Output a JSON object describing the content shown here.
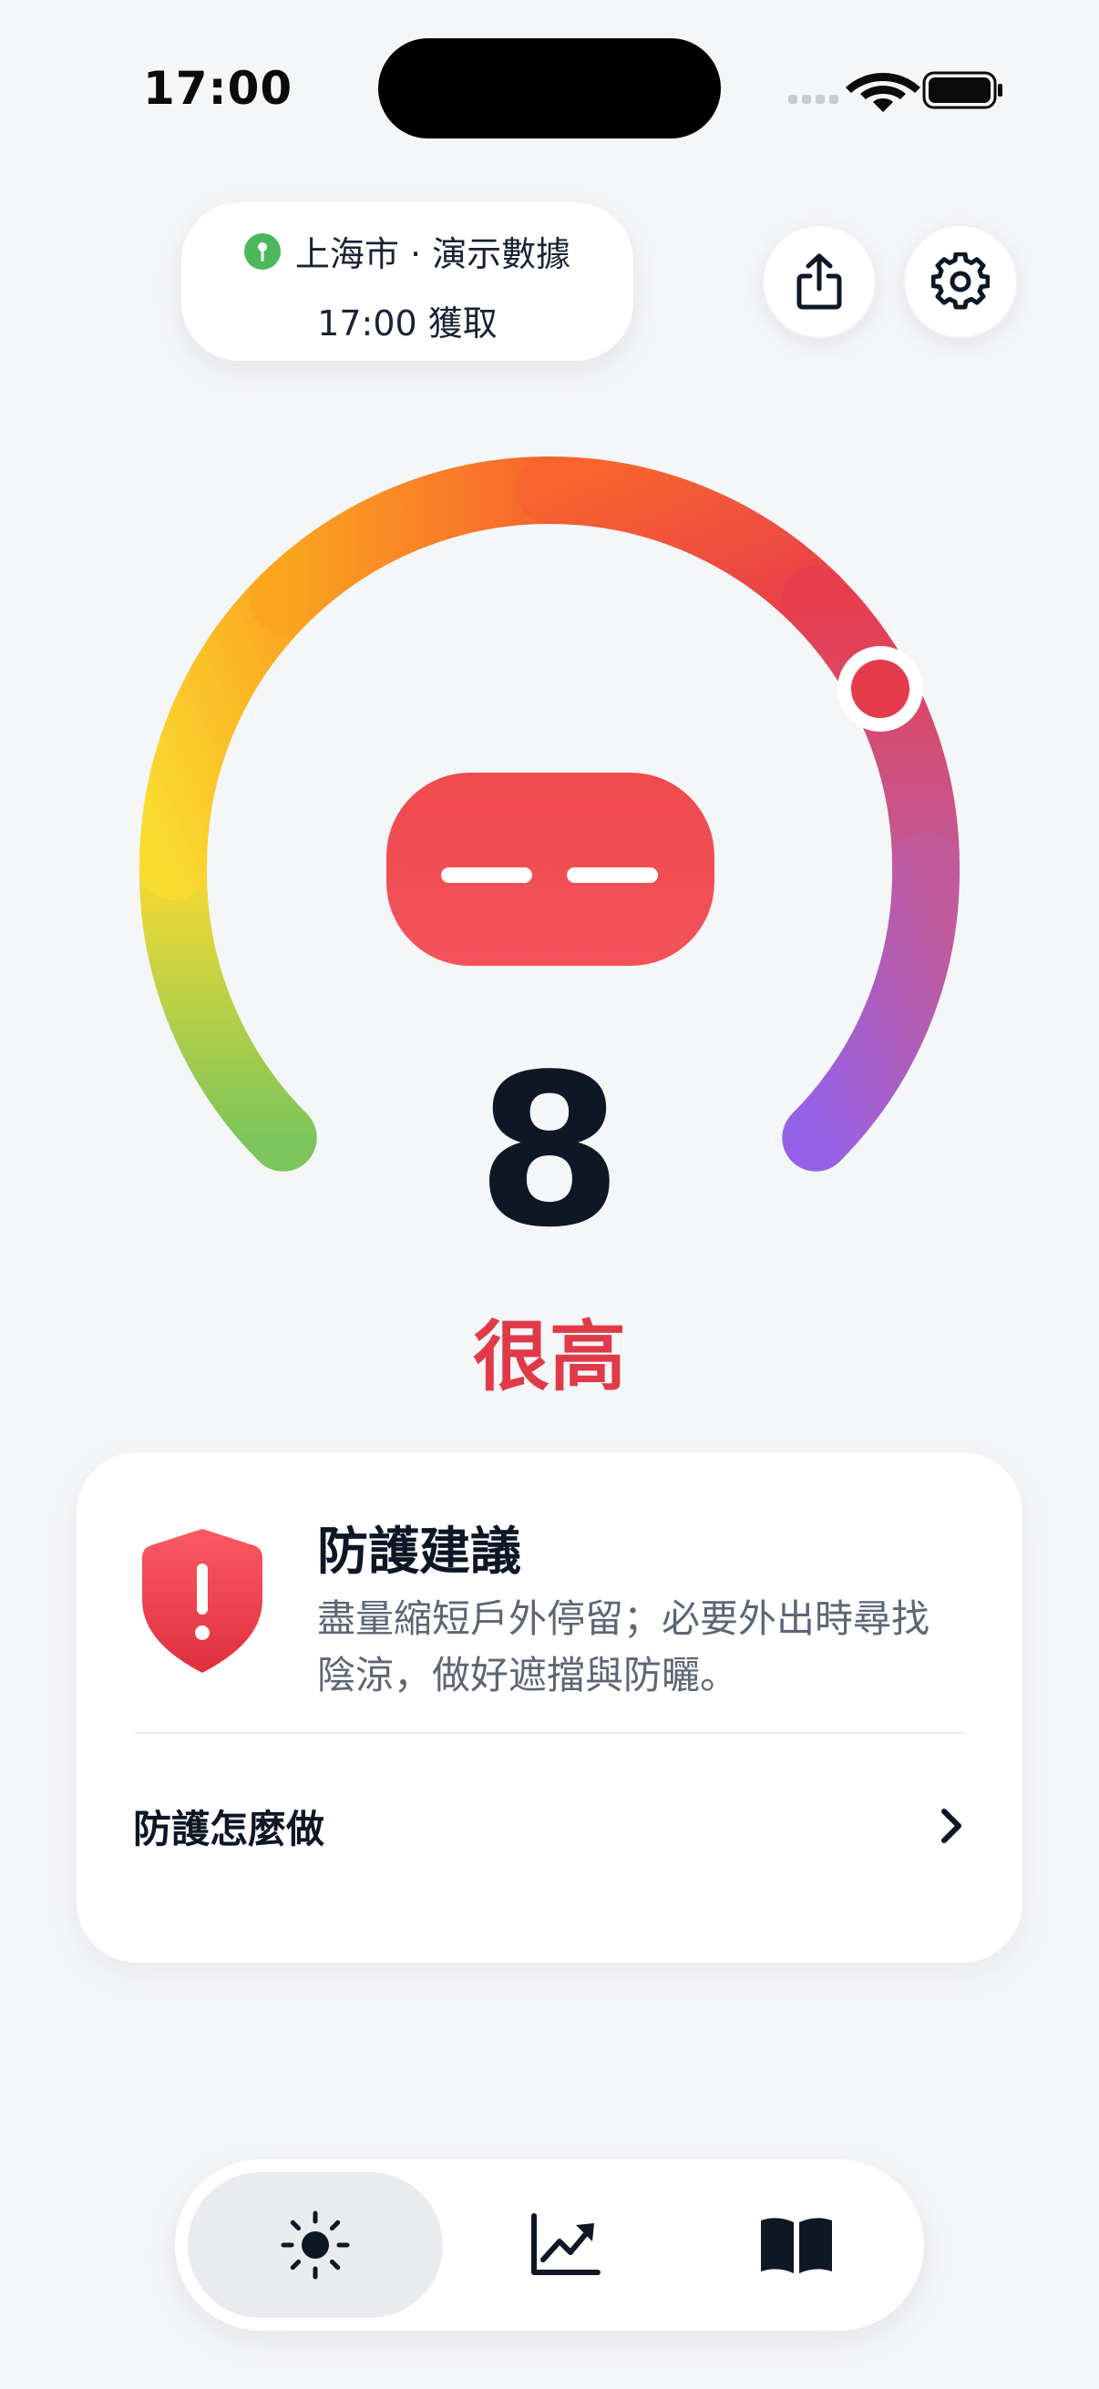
{
  "status_bar": {
    "time": "17:00"
  },
  "location": {
    "line1": "上海市 · 演示數據",
    "line2": "17:00 獲取"
  },
  "header_buttons": {
    "share_icon": "share-icon",
    "settings_icon": "gear-icon"
  },
  "uv": {
    "value": "8",
    "level": "很高",
    "max": 11,
    "indicator_color": "#E53B4A"
  },
  "advice": {
    "title": "防護建議",
    "text": "盡量縮短戶外停留；必要外出時尋找陰涼，做好遮擋與防曬。",
    "howto_label": "防護怎麼做"
  },
  "tabs": [
    {
      "icon": "sun-icon",
      "selected": true
    },
    {
      "icon": "trend-chart-icon",
      "selected": false
    },
    {
      "icon": "book-icon",
      "selected": false
    }
  ],
  "colors": {
    "accent_red": "#E03A48",
    "background": "#F5F6F8"
  }
}
